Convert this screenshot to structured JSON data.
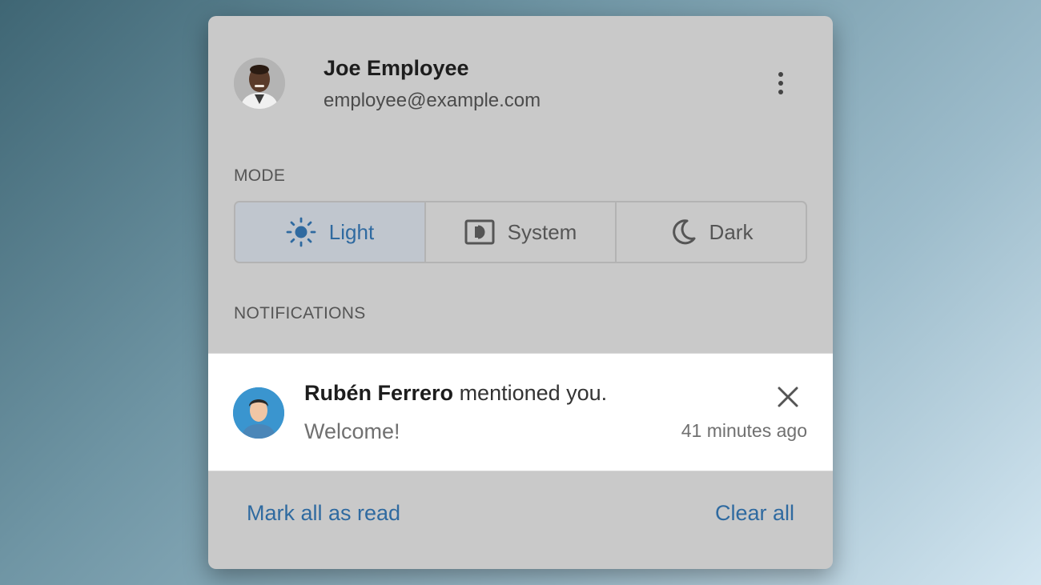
{
  "profile": {
    "name": "Joe Employee",
    "email": "employee@example.com",
    "avatar_icon": "user-avatar-photo",
    "menu_icon": "kebab-menu-icon"
  },
  "mode": {
    "label": "MODE",
    "selected": "Light",
    "options": [
      {
        "label": "Light",
        "icon": "sun-icon"
      },
      {
        "label": "System",
        "icon": "system-display-icon"
      },
      {
        "label": "Dark",
        "icon": "moon-icon"
      }
    ]
  },
  "notifications": {
    "label": "NOTIFICATIONS",
    "items": [
      {
        "author": "Rubén Ferrero",
        "action": "mentioned you.",
        "message": "Welcome!",
        "time": "41 minutes ago",
        "avatar_icon": "author-avatar-photo",
        "close_icon": "close-icon"
      }
    ]
  },
  "footer": {
    "mark_all_read": "Mark all as read",
    "clear_all": "Clear all"
  },
  "colors": {
    "accent": "#2f6aa0",
    "panel": "#c9c9c9",
    "card": "#ffffff"
  }
}
